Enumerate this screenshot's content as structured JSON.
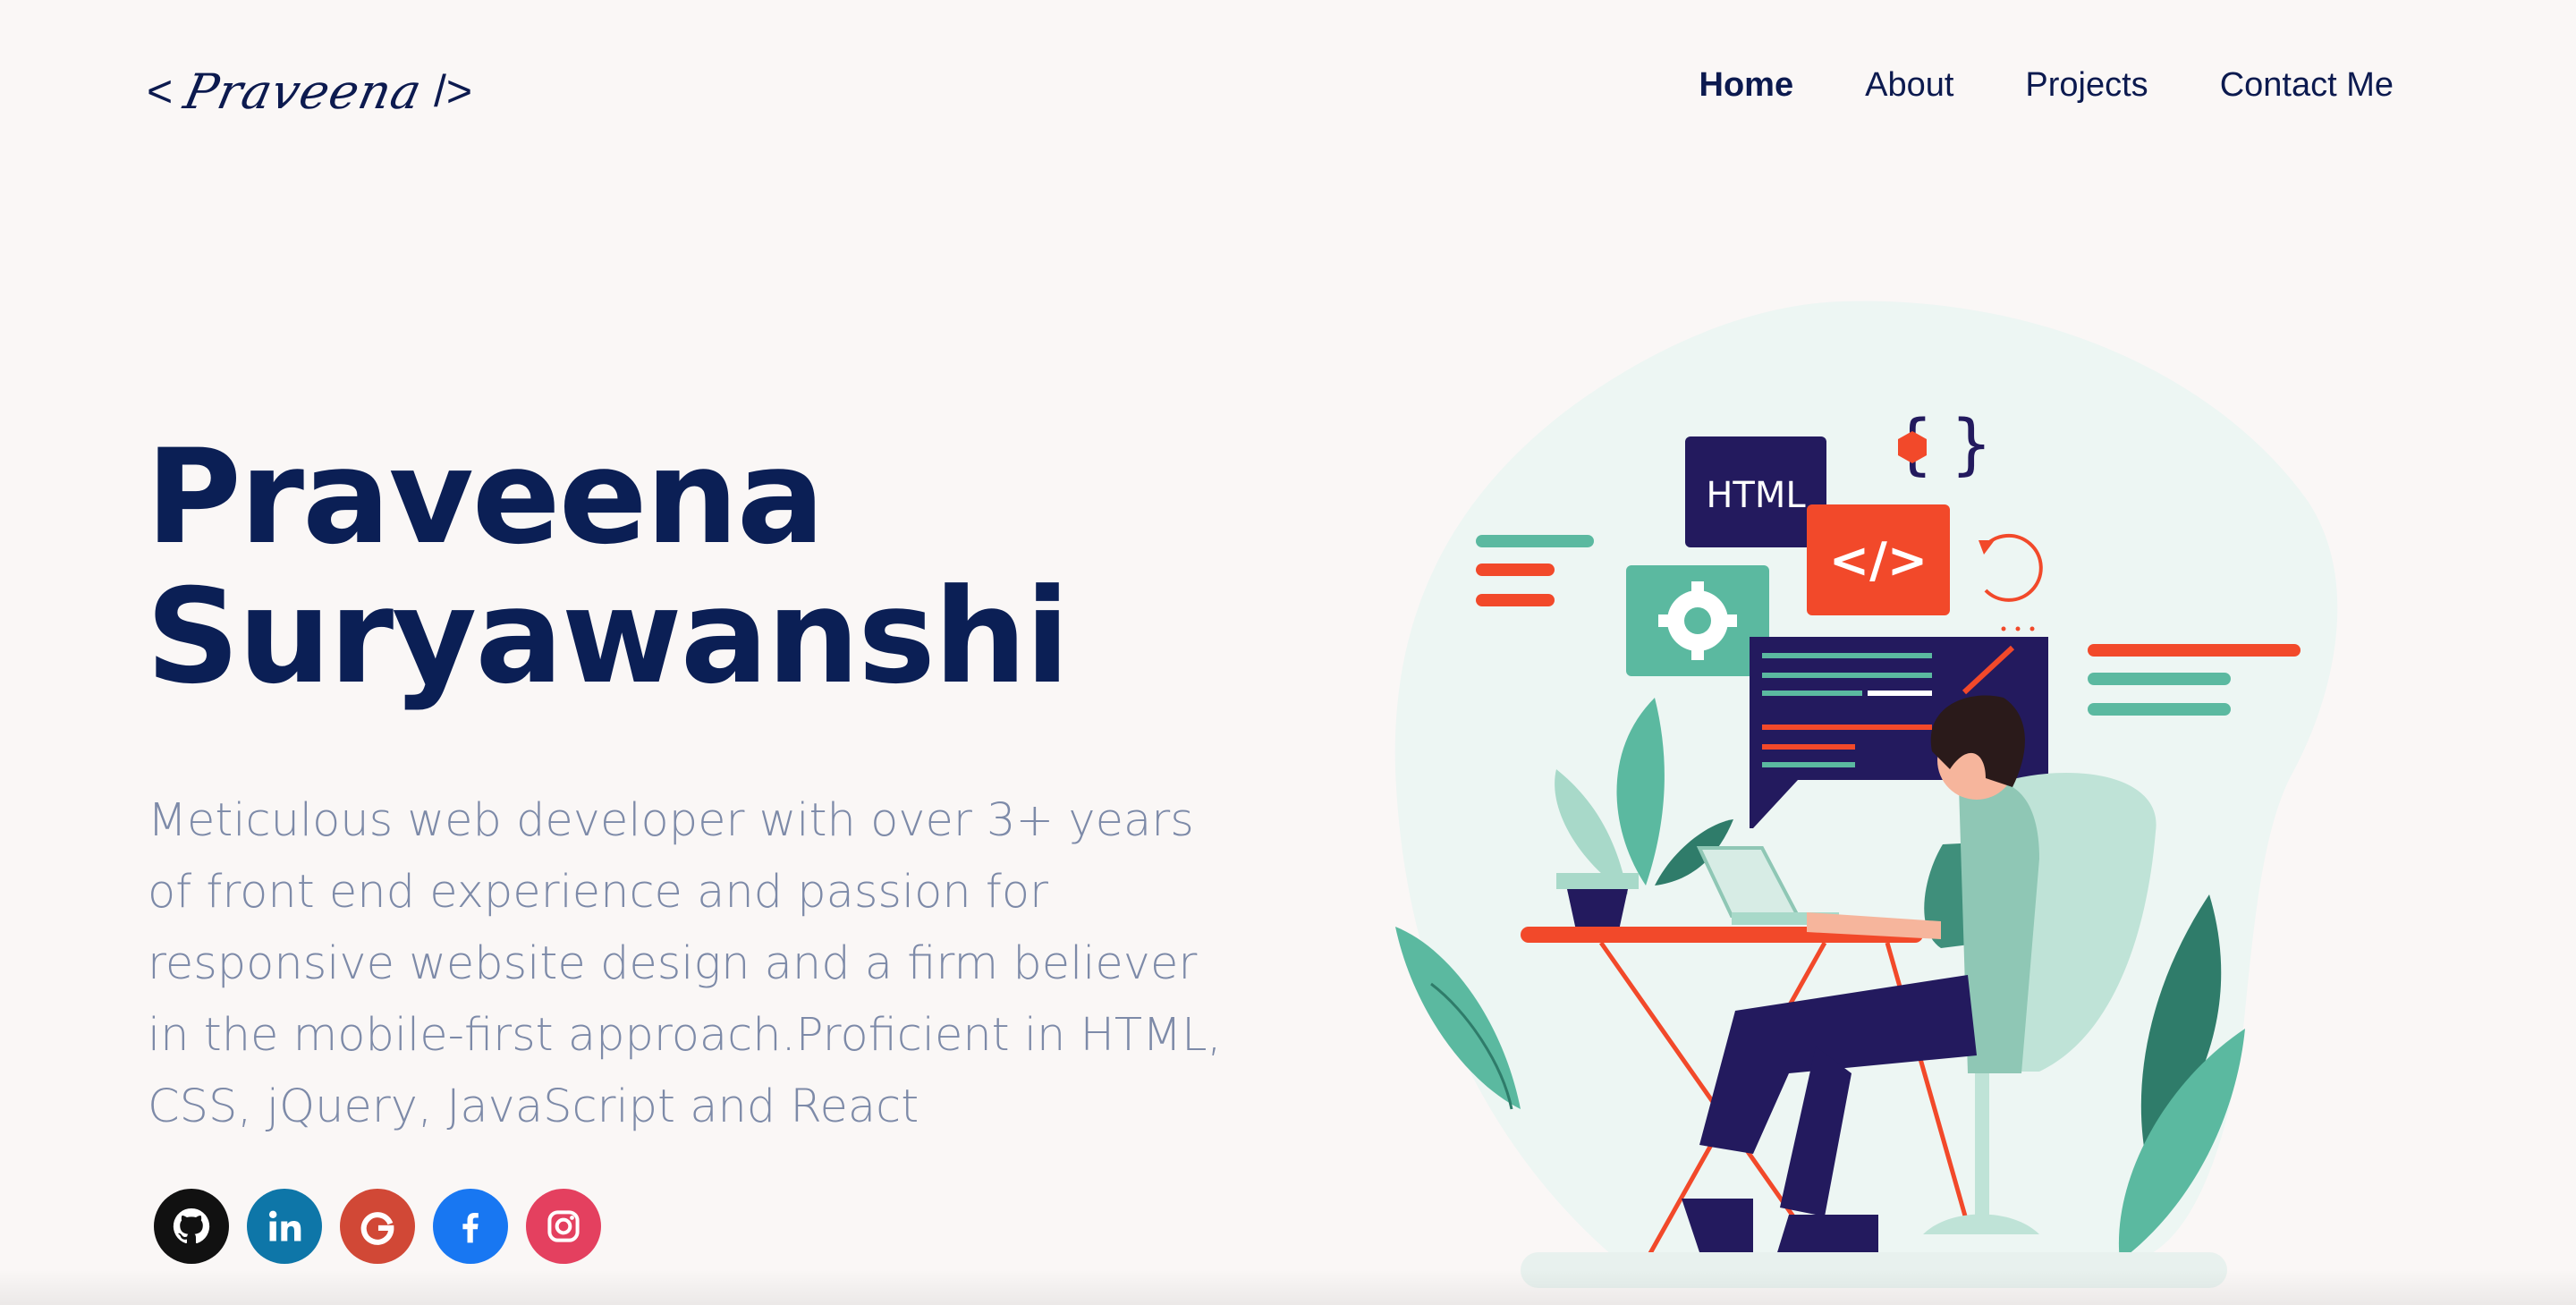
{
  "logo": {
    "open": "<",
    "name": "Praveena",
    "close": "/>"
  },
  "nav": [
    {
      "label": "Home",
      "active": true
    },
    {
      "label": "About",
      "active": false
    },
    {
      "label": "Projects",
      "active": false
    },
    {
      "label": "Contact Me",
      "active": false
    }
  ],
  "hero": {
    "title_line1": "Praveena",
    "title_line2": "Suryawanshi",
    "description": "Meticulous web developer with over 3+ years of front end experience and passion for responsive website design and a firm believer in the mobile-first approach.Proficient in HTML, CSS, jQuery, JavaScript and React"
  },
  "socials": [
    {
      "icon": "github-icon",
      "color": "#111111"
    },
    {
      "icon": "linkedin-icon",
      "color": "#0e76a8"
    },
    {
      "icon": "google-icon",
      "color": "#d14836"
    },
    {
      "icon": "facebook-icon",
      "color": "#1877f2"
    },
    {
      "icon": "instagram-icon",
      "color": "#e4405f"
    }
  ],
  "illustration": {
    "html_label": "HTML",
    "code_label": "</>"
  },
  "colors": {
    "navy": "#0b1f55",
    "text_muted": "#7d8aa8",
    "teal": "#5bb9a0",
    "accent_red": "#f2492a",
    "dark_panel": "#231a5e",
    "background": "#faf7f6"
  }
}
